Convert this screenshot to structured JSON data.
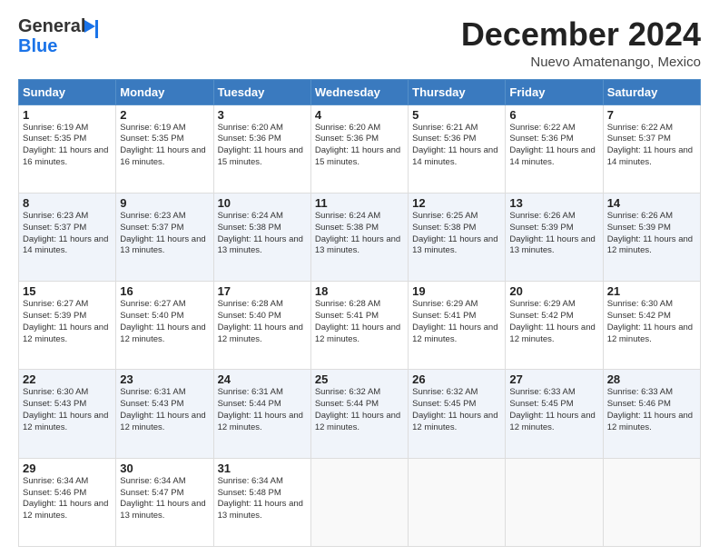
{
  "header": {
    "logo_general": "General",
    "logo_blue": "Blue",
    "month_title": "December 2024",
    "subtitle": "Nuevo Amatenango, Mexico"
  },
  "days_of_week": [
    "Sunday",
    "Monday",
    "Tuesday",
    "Wednesday",
    "Thursday",
    "Friday",
    "Saturday"
  ],
  "weeks": [
    [
      {
        "day": "1",
        "sunrise": "Sunrise: 6:19 AM",
        "sunset": "Sunset: 5:35 PM",
        "daylight": "Daylight: 11 hours and 16 minutes."
      },
      {
        "day": "2",
        "sunrise": "Sunrise: 6:19 AM",
        "sunset": "Sunset: 5:35 PM",
        "daylight": "Daylight: 11 hours and 16 minutes."
      },
      {
        "day": "3",
        "sunrise": "Sunrise: 6:20 AM",
        "sunset": "Sunset: 5:36 PM",
        "daylight": "Daylight: 11 hours and 15 minutes."
      },
      {
        "day": "4",
        "sunrise": "Sunrise: 6:20 AM",
        "sunset": "Sunset: 5:36 PM",
        "daylight": "Daylight: 11 hours and 15 minutes."
      },
      {
        "day": "5",
        "sunrise": "Sunrise: 6:21 AM",
        "sunset": "Sunset: 5:36 PM",
        "daylight": "Daylight: 11 hours and 14 minutes."
      },
      {
        "day": "6",
        "sunrise": "Sunrise: 6:22 AM",
        "sunset": "Sunset: 5:36 PM",
        "daylight": "Daylight: 11 hours and 14 minutes."
      },
      {
        "day": "7",
        "sunrise": "Sunrise: 6:22 AM",
        "sunset": "Sunset: 5:37 PM",
        "daylight": "Daylight: 11 hours and 14 minutes."
      }
    ],
    [
      {
        "day": "8",
        "sunrise": "Sunrise: 6:23 AM",
        "sunset": "Sunset: 5:37 PM",
        "daylight": "Daylight: 11 hours and 14 minutes."
      },
      {
        "day": "9",
        "sunrise": "Sunrise: 6:23 AM",
        "sunset": "Sunset: 5:37 PM",
        "daylight": "Daylight: 11 hours and 13 minutes."
      },
      {
        "day": "10",
        "sunrise": "Sunrise: 6:24 AM",
        "sunset": "Sunset: 5:38 PM",
        "daylight": "Daylight: 11 hours and 13 minutes."
      },
      {
        "day": "11",
        "sunrise": "Sunrise: 6:24 AM",
        "sunset": "Sunset: 5:38 PM",
        "daylight": "Daylight: 11 hours and 13 minutes."
      },
      {
        "day": "12",
        "sunrise": "Sunrise: 6:25 AM",
        "sunset": "Sunset: 5:38 PM",
        "daylight": "Daylight: 11 hours and 13 minutes."
      },
      {
        "day": "13",
        "sunrise": "Sunrise: 6:26 AM",
        "sunset": "Sunset: 5:39 PM",
        "daylight": "Daylight: 11 hours and 13 minutes."
      },
      {
        "day": "14",
        "sunrise": "Sunrise: 6:26 AM",
        "sunset": "Sunset: 5:39 PM",
        "daylight": "Daylight: 11 hours and 12 minutes."
      }
    ],
    [
      {
        "day": "15",
        "sunrise": "Sunrise: 6:27 AM",
        "sunset": "Sunset: 5:39 PM",
        "daylight": "Daylight: 11 hours and 12 minutes."
      },
      {
        "day": "16",
        "sunrise": "Sunrise: 6:27 AM",
        "sunset": "Sunset: 5:40 PM",
        "daylight": "Daylight: 11 hours and 12 minutes."
      },
      {
        "day": "17",
        "sunrise": "Sunrise: 6:28 AM",
        "sunset": "Sunset: 5:40 PM",
        "daylight": "Daylight: 11 hours and 12 minutes."
      },
      {
        "day": "18",
        "sunrise": "Sunrise: 6:28 AM",
        "sunset": "Sunset: 5:41 PM",
        "daylight": "Daylight: 11 hours and 12 minutes."
      },
      {
        "day": "19",
        "sunrise": "Sunrise: 6:29 AM",
        "sunset": "Sunset: 5:41 PM",
        "daylight": "Daylight: 11 hours and 12 minutes."
      },
      {
        "day": "20",
        "sunrise": "Sunrise: 6:29 AM",
        "sunset": "Sunset: 5:42 PM",
        "daylight": "Daylight: 11 hours and 12 minutes."
      },
      {
        "day": "21",
        "sunrise": "Sunrise: 6:30 AM",
        "sunset": "Sunset: 5:42 PM",
        "daylight": "Daylight: 11 hours and 12 minutes."
      }
    ],
    [
      {
        "day": "22",
        "sunrise": "Sunrise: 6:30 AM",
        "sunset": "Sunset: 5:43 PM",
        "daylight": "Daylight: 11 hours and 12 minutes."
      },
      {
        "day": "23",
        "sunrise": "Sunrise: 6:31 AM",
        "sunset": "Sunset: 5:43 PM",
        "daylight": "Daylight: 11 hours and 12 minutes."
      },
      {
        "day": "24",
        "sunrise": "Sunrise: 6:31 AM",
        "sunset": "Sunset: 5:44 PM",
        "daylight": "Daylight: 11 hours and 12 minutes."
      },
      {
        "day": "25",
        "sunrise": "Sunrise: 6:32 AM",
        "sunset": "Sunset: 5:44 PM",
        "daylight": "Daylight: 11 hours and 12 minutes."
      },
      {
        "day": "26",
        "sunrise": "Sunrise: 6:32 AM",
        "sunset": "Sunset: 5:45 PM",
        "daylight": "Daylight: 11 hours and 12 minutes."
      },
      {
        "day": "27",
        "sunrise": "Sunrise: 6:33 AM",
        "sunset": "Sunset: 5:45 PM",
        "daylight": "Daylight: 11 hours and 12 minutes."
      },
      {
        "day": "28",
        "sunrise": "Sunrise: 6:33 AM",
        "sunset": "Sunset: 5:46 PM",
        "daylight": "Daylight: 11 hours and 12 minutes."
      }
    ],
    [
      {
        "day": "29",
        "sunrise": "Sunrise: 6:34 AM",
        "sunset": "Sunset: 5:46 PM",
        "daylight": "Daylight: 11 hours and 12 minutes."
      },
      {
        "day": "30",
        "sunrise": "Sunrise: 6:34 AM",
        "sunset": "Sunset: 5:47 PM",
        "daylight": "Daylight: 11 hours and 13 minutes."
      },
      {
        "day": "31",
        "sunrise": "Sunrise: 6:34 AM",
        "sunset": "Sunset: 5:48 PM",
        "daylight": "Daylight: 11 hours and 13 minutes."
      },
      null,
      null,
      null,
      null
    ]
  ]
}
